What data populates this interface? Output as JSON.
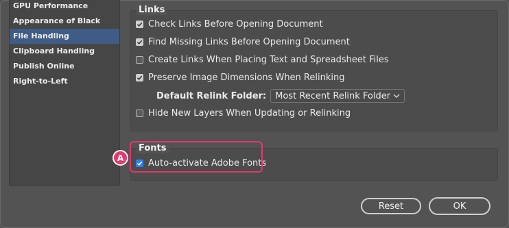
{
  "sidebar": {
    "items": [
      {
        "label": "GPU Performance"
      },
      {
        "label": "Appearance of Black"
      },
      {
        "label": "File Handling"
      },
      {
        "label": "Clipboard Handling"
      },
      {
        "label": "Publish Online"
      },
      {
        "label": "Right-to-Left"
      }
    ],
    "selected": "File Handling"
  },
  "links_group": {
    "title": "Links",
    "options": [
      {
        "label": "Check Links Before Opening Document",
        "checked": true
      },
      {
        "label": "Find Missing Links Before Opening Document",
        "checked": true
      },
      {
        "label": "Create Links When Placing Text and Spreadsheet Files",
        "checked": false
      },
      {
        "label": "Preserve Image Dimensions When Relinking",
        "checked": true
      }
    ],
    "relink_folder": {
      "label": "Default Relink Folder:",
      "value": "Most Recent Relink Folder"
    },
    "hide_layers": {
      "label": "Hide New Layers When Updating or Relinking",
      "checked": false
    }
  },
  "fonts_group": {
    "title": "Fonts",
    "auto_activate": {
      "label": "Auto-activate Adobe Fonts",
      "checked": true
    }
  },
  "callout": {
    "badge": "A",
    "color": "#e03b6d"
  },
  "buttons": {
    "reset": "Reset",
    "ok": "OK"
  },
  "colors": {
    "selected_bg": "#3e5c86",
    "checkbox_blue": "#2f80ed"
  }
}
